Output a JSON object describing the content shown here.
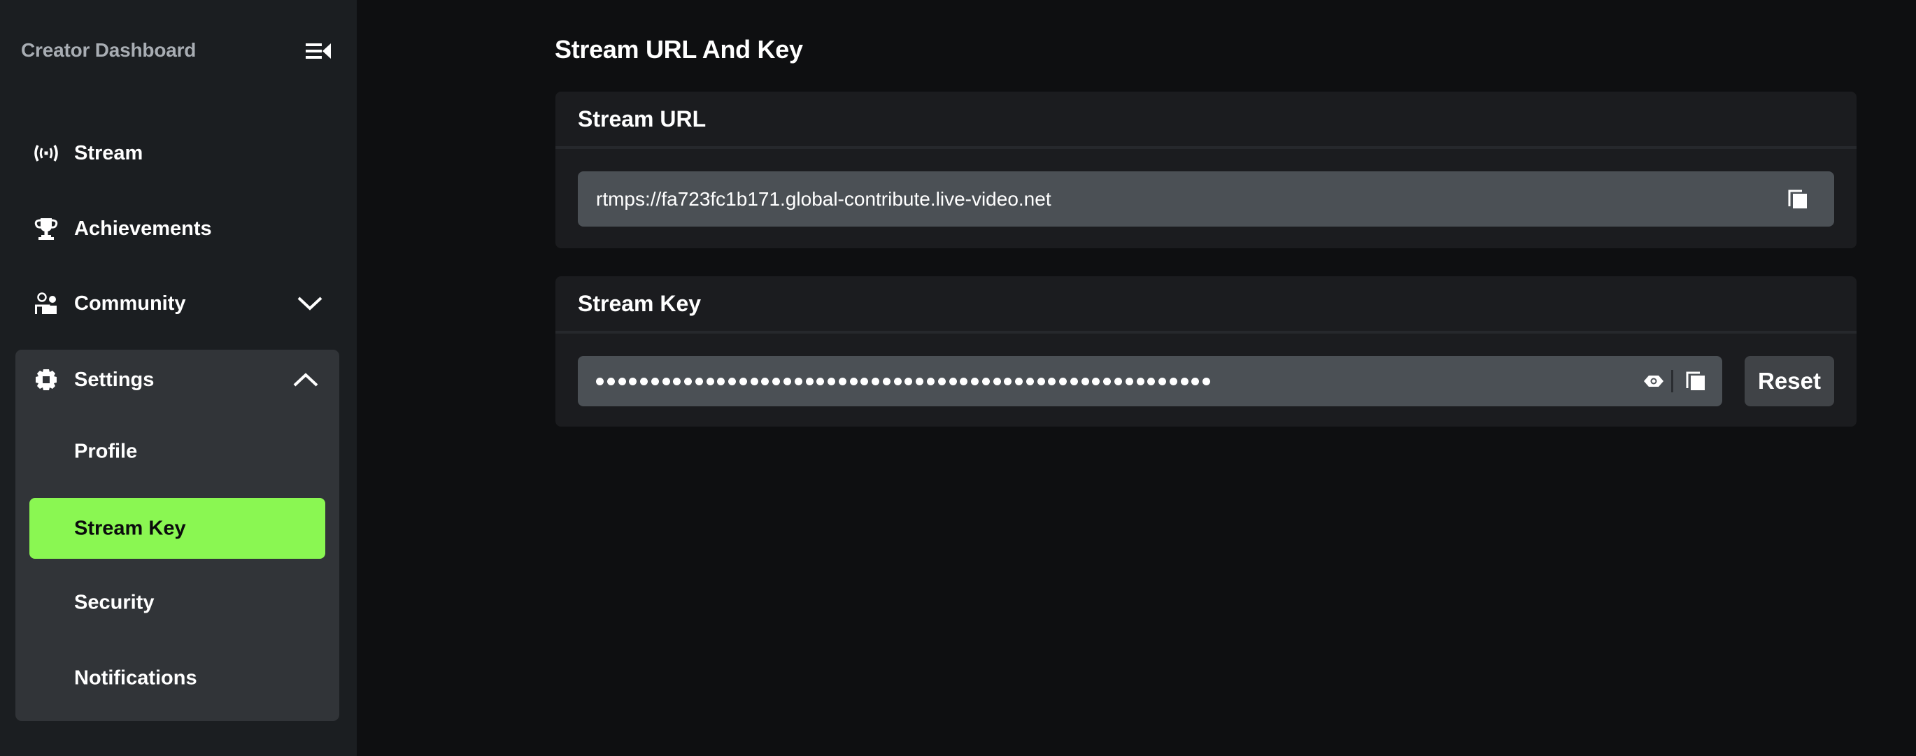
{
  "sidebar": {
    "title": "Creator Dashboard",
    "collapse_icon": "collapse-sidebar-icon",
    "items": [
      {
        "label": "Stream",
        "icon": "broadcast-icon"
      },
      {
        "label": "Achievements",
        "icon": "trophy-icon"
      },
      {
        "label": "Community",
        "icon": "community-icon",
        "expanded": false
      },
      {
        "label": "Settings",
        "icon": "gear-icon",
        "expanded": true
      }
    ],
    "settings_subitems": [
      {
        "label": "Profile",
        "active": false
      },
      {
        "label": "Stream Key",
        "active": true
      },
      {
        "label": "Security",
        "active": false
      },
      {
        "label": "Notifications",
        "active": false
      }
    ]
  },
  "main": {
    "title": "Stream URL And Key",
    "stream_url": {
      "header": "Stream URL",
      "value": "rtmps://fa723fc1b171.global-contribute.live-video.net",
      "copy_icon": "copy-icon"
    },
    "stream_key": {
      "header": "Stream Key",
      "masked_length": 56,
      "show_icon": "eye-icon",
      "copy_icon": "copy-icon",
      "reset_label": "Reset"
    }
  },
  "colors": {
    "accent": "#8af752",
    "sidebar_bg": "#1b1e21",
    "main_bg": "#0e0f11",
    "group_bg": "#313438",
    "card_bg": "#1b1c1f",
    "field_bg": "#4b5055",
    "button_bg": "#404347",
    "brand_text": "#a8adb3"
  }
}
